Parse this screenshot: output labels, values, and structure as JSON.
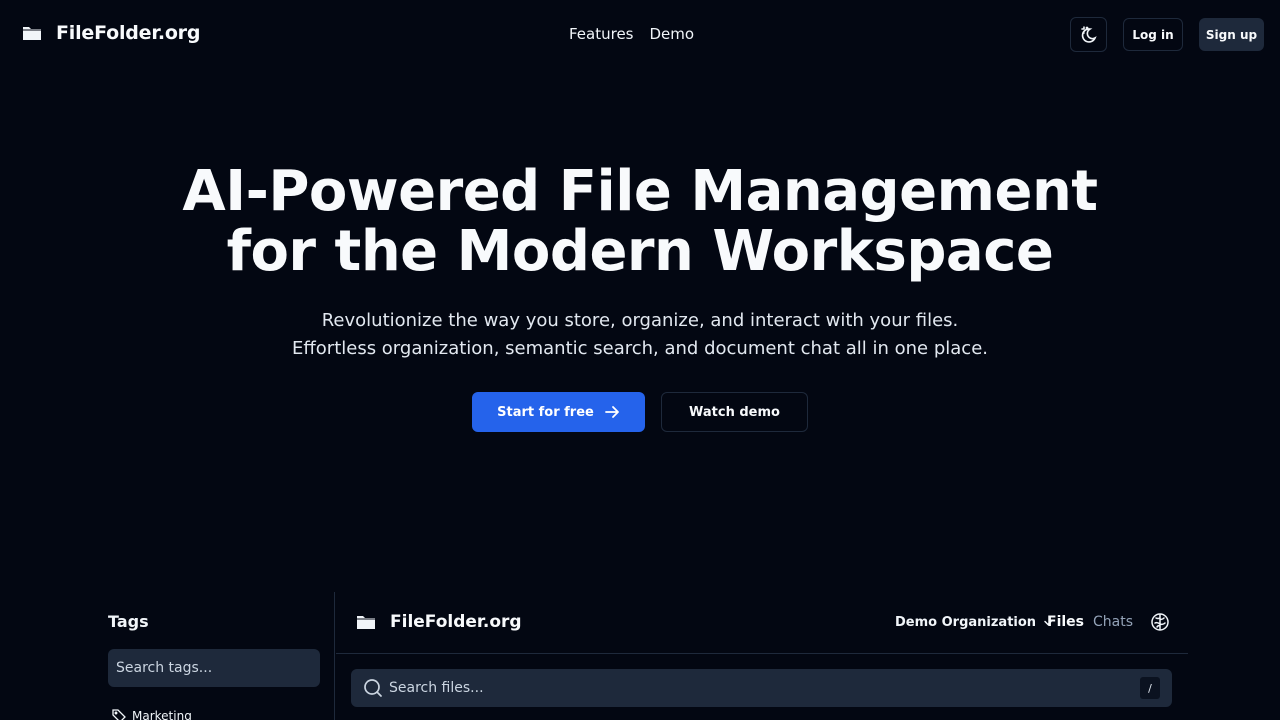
{
  "nav": {
    "brand": "FileFolder.org",
    "links": [
      "Features",
      "Demo"
    ],
    "login": "Log in",
    "signup": "Sign up"
  },
  "hero": {
    "title_line1": "AI-Powered File Management",
    "title_line2": "for the Modern Workspace",
    "subtitle_line1": "Revolutionize the way you store, organize, and interact with your files.",
    "subtitle_line2": "Effortless organization, semantic search, and document chat all in one place.",
    "cta_primary": "Start for free",
    "cta_secondary": "Watch demo"
  },
  "demo": {
    "tags_title": "Tags",
    "tags_search_placeholder": "Search tags...",
    "tags": [
      "Marketing"
    ],
    "brand": "FileFolder.org",
    "organization": "Demo Organization",
    "tabs": [
      "Files",
      "Chats"
    ],
    "files_search_placeholder": "Search files...",
    "shortcut": "/"
  },
  "colors": {
    "background": "#030712",
    "primary": "#2563eb",
    "surface": "#1e293b",
    "muted_text": "#94a3b8"
  },
  "icons": {
    "brand": "folder-icon",
    "theme": "moon-sun-icon",
    "cta": "arrow-right-icon",
    "tag": "tag-icon",
    "org_dropdown": "chevron-down-icon",
    "ai": "brain-icon",
    "search": "search-icon"
  }
}
